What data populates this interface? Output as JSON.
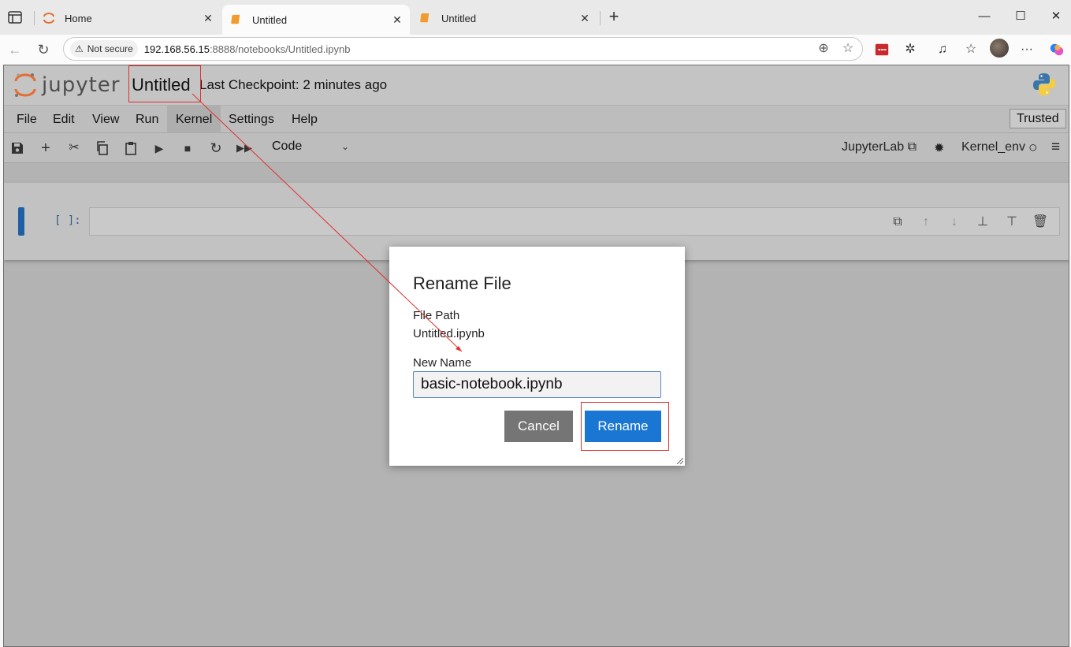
{
  "browser": {
    "tabs": [
      {
        "title": "Home",
        "active": false
      },
      {
        "title": "Untitled",
        "active": true
      },
      {
        "title": "Untitled",
        "active": false
      }
    ],
    "security_label": "Not secure",
    "url_host": "192.168.56.15",
    "url_rest": ":8888/notebooks/Untitled.ipynb"
  },
  "jupyter": {
    "logo_text": "jupyter",
    "notebook_title": "Untitled",
    "checkpoint": "Last Checkpoint: 2 minutes ago",
    "menu": [
      "File",
      "Edit",
      "View",
      "Run",
      "Kernel",
      "Settings",
      "Help"
    ],
    "trusted_label": "Trusted",
    "cell_type": "Code",
    "jupyterlab_label": "JupyterLab",
    "kernel_label": "Kernel_env",
    "cell_prompt": "[ ]:"
  },
  "dialog": {
    "title": "Rename File",
    "path_label": "File Path",
    "path_value": "Untitled.ipynb",
    "new_name_label": "New Name",
    "new_name_value": "basic-notebook.ipynb",
    "cancel_label": "Cancel",
    "rename_label": "Rename"
  },
  "colors": {
    "accent": "#1976d2",
    "cancel": "#757575",
    "annotation": "#e0302d",
    "cell_marker": "#1f5fa6"
  }
}
